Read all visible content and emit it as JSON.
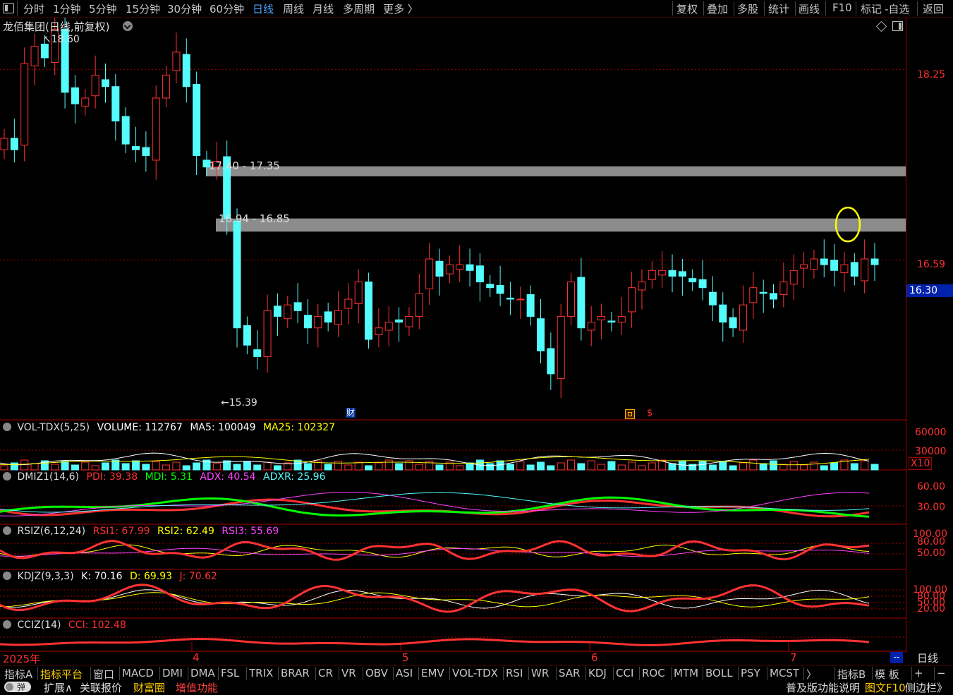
{
  "toolbar": {
    "tabs": [
      "分时",
      "1分钟",
      "5分钟",
      "15分钟",
      "30分钟",
      "60分钟",
      "日线",
      "周线",
      "月线",
      "多周期",
      "更多 〉"
    ],
    "active": "日线",
    "right_tabs": [
      "复权",
      "叠加",
      "多股",
      "统计",
      "画线",
      "F10",
      "标记",
      "-自选",
      "返回"
    ]
  },
  "chart_header": {
    "title": "龙佰集团(日线,前复权)"
  },
  "price_axis": {
    "labels": [
      "18.25",
      "16.59"
    ],
    "current_price": "16.30"
  },
  "annotations": {
    "high_label": "18.60",
    "low_label": "15.39",
    "zone1_label": "17.40 - 17.35",
    "zone2_label": "16.94 - 16.85",
    "marker_cai": "财",
    "marker_dollar": "$"
  },
  "volume_panel": {
    "name": "VOL-TDX(5,25)",
    "volume": "VOLUME: 112767",
    "ma5": "MA5: 100049",
    "ma25": "MA25: 102327",
    "axis": [
      "60000",
      "30000"
    ],
    "unit": "X10"
  },
  "dmi_panel": {
    "name": "DMIZ1(14,6)",
    "pdi": "PDI: 39.38",
    "mdi": "MDI: 5.31",
    "adx": "ADX: 40.54",
    "adxr": "ADXR: 25.96",
    "axis": [
      "60.00",
      "30.00"
    ]
  },
  "rsi_panel": {
    "name": "RSIZ(6,12,24)",
    "rsi1": "RSI1: 67.99",
    "rsi2": "RSI2: 62.49",
    "rsi3": "RSI3: 55.69",
    "axis": [
      "100.00",
      "80.00",
      "50.00"
    ]
  },
  "kdj_panel": {
    "name": "KDJZ(9,3,3)",
    "k": "K: 70.16",
    "d": "D: 69.93",
    "j": "J: 70.62",
    "axis": [
      "100.00",
      "80.00",
      "50.00",
      "20.00"
    ]
  },
  "cci_panel": {
    "name": "CCIZ(14)",
    "cci": "CCI: 102.48"
  },
  "time_axis": {
    "labels": [
      "2025年",
      "4",
      "5",
      "6",
      "7"
    ],
    "period": "日线",
    "right_marker": "--"
  },
  "indicator_bar": {
    "items": [
      "指标A",
      "指标平台",
      "窗口",
      "MACD",
      "DMI",
      "DMA",
      "FSL",
      "TRIX",
      "BRAR",
      "CR",
      "VR",
      "OBV",
      "ASI",
      "EMV",
      "VOL-TDX",
      "RSI",
      "WR",
      "SAR",
      "KDJ",
      "CCI",
      "ROC",
      "MTM",
      "BOLL",
      "PSY",
      "MCST",
      "〉",
      "指标B",
      "模 板",
      "+",
      "−"
    ]
  },
  "status_bar": {
    "toggle": "弹",
    "items": [
      "扩展∧",
      "关联报价",
      "财富圈",
      "增值功能"
    ],
    "right": [
      "普及版功能说明",
      "图文F10",
      "侧边栏》"
    ]
  },
  "colors": {
    "up": "#ff3232",
    "down": "#54fcfc",
    "background": "#000000",
    "grid": "#aa0000",
    "zone": "#8c8c8c",
    "circle": "#ffff00"
  },
  "chart_data": {
    "type": "candlestick",
    "ylim": [
      15.2,
      18.7
    ],
    "high": 18.6,
    "low": 15.39,
    "last": 16.3,
    "zones": [
      [
        17.4,
        17.35
      ],
      [
        16.94,
        16.85
      ]
    ]
  }
}
